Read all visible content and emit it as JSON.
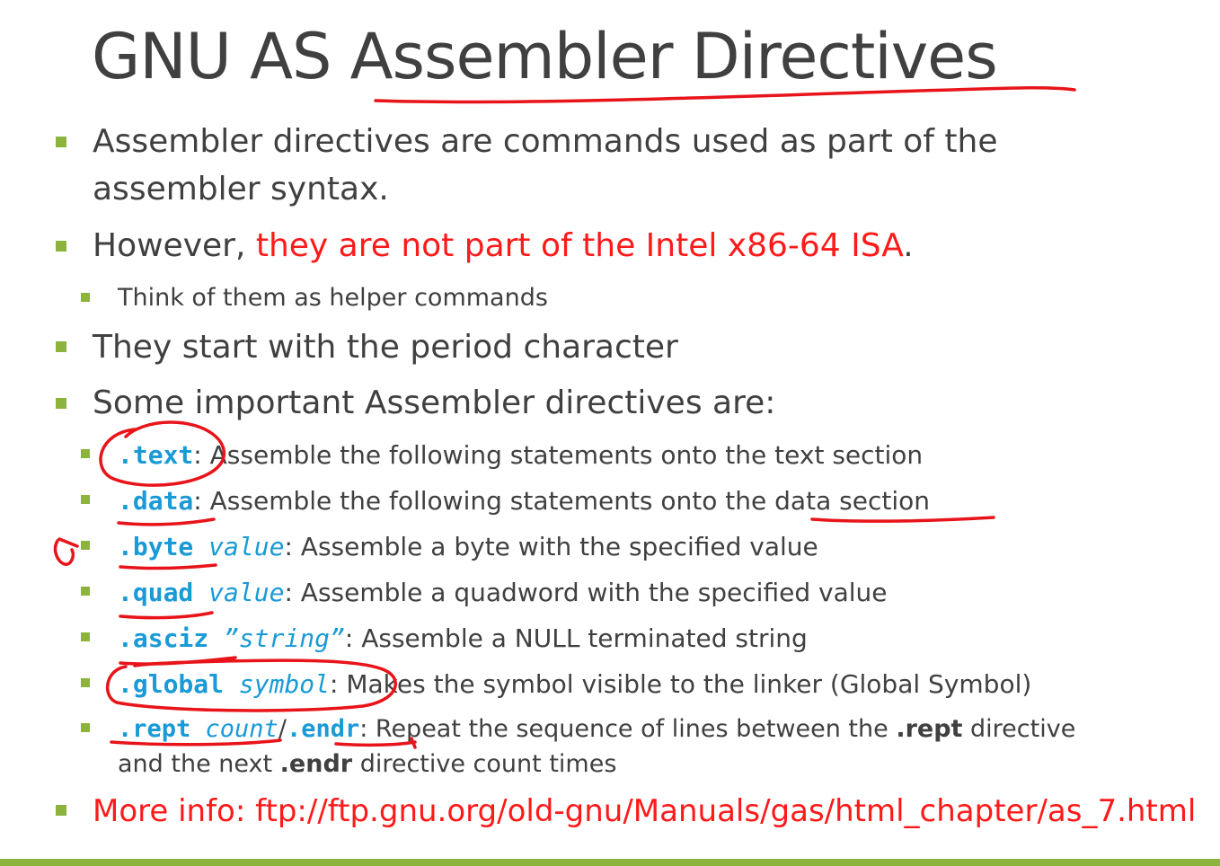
{
  "title": "GNU AS Assembler Directives",
  "bullets": {
    "b1_line1": "Assembler directives are commands used as part of the",
    "b1_line2": "assembler syntax.",
    "b2_prefix": "However, ",
    "b2_red": "they are not part of the Intel x86-64 ISA",
    "b2_suffix": ".",
    "b2_sub": "Think of them as helper commands",
    "b3": "They start with the period character",
    "b4": "Some important Assembler directives are:"
  },
  "directives": [
    {
      "code": ".text",
      "arg": "",
      "sep": ":",
      "desc": " Assemble the following statements onto the text section"
    },
    {
      "code": ".data",
      "arg": "",
      "sep": ":",
      "desc": " Assemble the following statements onto the data section"
    },
    {
      "code": ".byte",
      "arg": " value",
      "sep": ":",
      "desc": "  Assemble a byte with the specified value"
    },
    {
      "code": ".quad",
      "arg": " value",
      "sep": ":",
      "desc": " Assemble a quadword with the specified value"
    },
    {
      "code": ".asciz",
      "arg": " ”string”",
      "sep": ":",
      "desc": " Assemble a NULL terminated string"
    },
    {
      "code": ".global",
      "arg": " symbol",
      "sep": ":",
      "desc": " Makes the symbol visible to the linker (Global Symbol)"
    }
  ],
  "rept": {
    "code1": ".rept",
    "arg": " count",
    "slash": "/",
    "code2": ".endr",
    "desc1": ": Repeat the sequence of lines between the ",
    "bold1": ".rept",
    "desc2": " directive",
    "line2a": "and the next ",
    "bold2": ".endr",
    "line2b": " directive count times"
  },
  "more_info": "More info: ftp://ftp.gnu.org/old-gnu/Manuals/gas/html_chapter/as_7.html",
  "colors": {
    "bullet": "#8cb43c",
    "text": "#404040",
    "red": "#ff1a1a",
    "code": "#1a9ad6",
    "ink": "#e8141a"
  }
}
